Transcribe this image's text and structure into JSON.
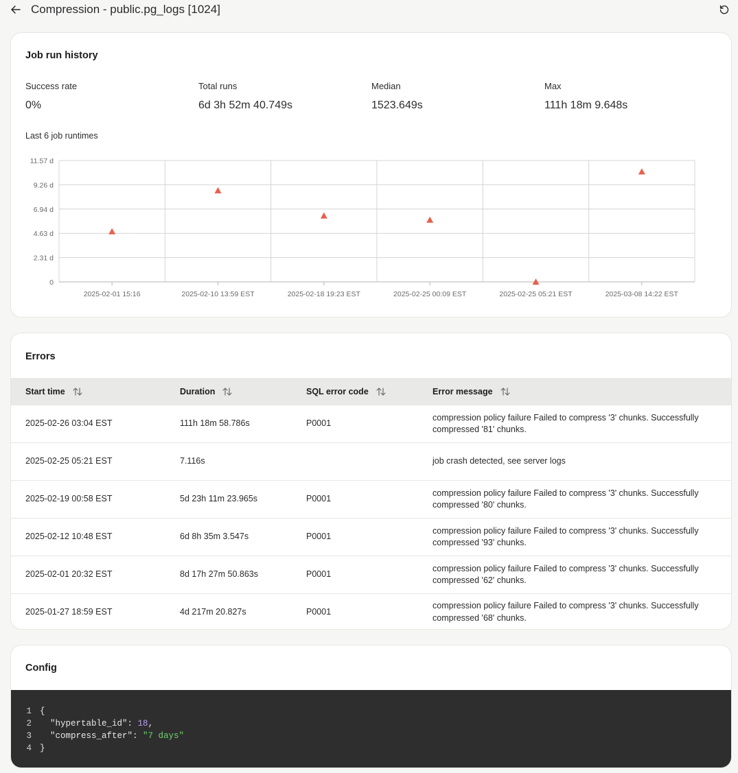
{
  "header": {
    "title": "Compression - public.pg_logs [1024]",
    "back_icon": "arrow-left-icon",
    "refresh_icon": "refresh-icon"
  },
  "history": {
    "title": "Job run history",
    "stats": [
      {
        "label": "Success rate",
        "value": "0%"
      },
      {
        "label": "Total runs",
        "value": "6d 3h 52m 40.749s"
      },
      {
        "label": "Median",
        "value": "1523.649s"
      },
      {
        "label": "Max",
        "value": "111h 18m 9.648s"
      }
    ],
    "chart_label": "Last 6 job runtimes"
  },
  "chart_data": {
    "type": "scatter",
    "marker": "triangle",
    "marker_color": "#e8604c",
    "categories": [
      "2025-02-01 15:16",
      "2025-02-10 13:59 EST",
      "2025-02-18 19:23 EST",
      "2025-02-25 00:09 EST",
      "2025-02-25 05:21 EST",
      "2025-03-08 14:22 EST"
    ],
    "values": [
      4.8,
      8.7,
      6.3,
      5.9,
      0.0,
      10.5
    ],
    "unit": "d",
    "ylim": [
      0,
      11.57
    ],
    "yticks": [
      "0",
      "2.31 d",
      "4.63 d",
      "6.94 d",
      "9.26 d",
      "11.57 d"
    ],
    "grid": true
  },
  "errors": {
    "title": "Errors",
    "columns": [
      "Start time",
      "Duration",
      "SQL error code",
      "Error message"
    ],
    "sort_icon": "sort-icon",
    "rows": [
      [
        "2025-02-26 03:04 EST",
        "111h 18m 58.786s",
        "P0001",
        "compression policy failure Failed to compress '3' chunks. Successfully compressed '81' chunks."
      ],
      [
        "2025-02-25 05:21 EST",
        "7.116s",
        "",
        "job crash detected, see server logs"
      ],
      [
        "2025-02-19 00:58 EST",
        "5d 23h 11m 23.965s",
        "P0001",
        "compression policy failure Failed to compress '3' chunks. Successfully compressed '80' chunks."
      ],
      [
        "2025-02-12 10:48 EST",
        "6d 8h 35m 3.547s",
        "P0001",
        "compression policy failure Failed to compress '3' chunks. Successfully compressed '93' chunks."
      ],
      [
        "2025-02-01 20:32 EST",
        "8d 17h 27m 50.863s",
        "P0001",
        "compression policy failure Failed to compress '3' chunks. Successfully compressed '62' chunks."
      ],
      [
        "2025-01-27 18:59 EST",
        "4d 217m 20.827s",
        "P0001",
        "compression policy failure Failed to compress '3' chunks. Successfully compressed '68' chunks."
      ]
    ]
  },
  "config": {
    "title": "Config",
    "lines": [
      {
        "n": "1",
        "open": "{"
      },
      {
        "n": "2",
        "key": "\"hypertable_id\"",
        "val": "18",
        "tail": ","
      },
      {
        "n": "3",
        "key": "\"compress_after\"",
        "val": "\"7 days\"",
        "tail": ""
      },
      {
        "n": "4",
        "close": "}"
      }
    ]
  }
}
